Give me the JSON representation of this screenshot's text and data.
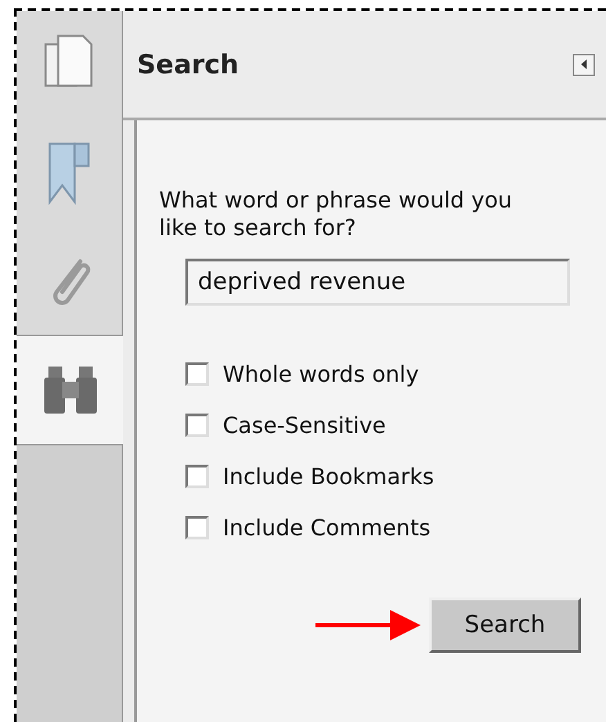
{
  "sidebar": {
    "tabs": [
      {
        "kind": "pages",
        "selected": false
      },
      {
        "kind": "bookmarks",
        "selected": false
      },
      {
        "kind": "attachments",
        "selected": false
      },
      {
        "kind": "search",
        "selected": true
      }
    ]
  },
  "panel": {
    "title": "Search",
    "prompt": "What word or phrase would you like to search for?",
    "search_field": {
      "value": "deprived revenue"
    },
    "options": [
      {
        "label": "Whole words only",
        "checked": false
      },
      {
        "label": "Case-Sensitive",
        "checked": false
      },
      {
        "label": "Include Bookmarks",
        "checked": false
      },
      {
        "label": "Include Comments",
        "checked": false
      }
    ],
    "button": "Search"
  }
}
